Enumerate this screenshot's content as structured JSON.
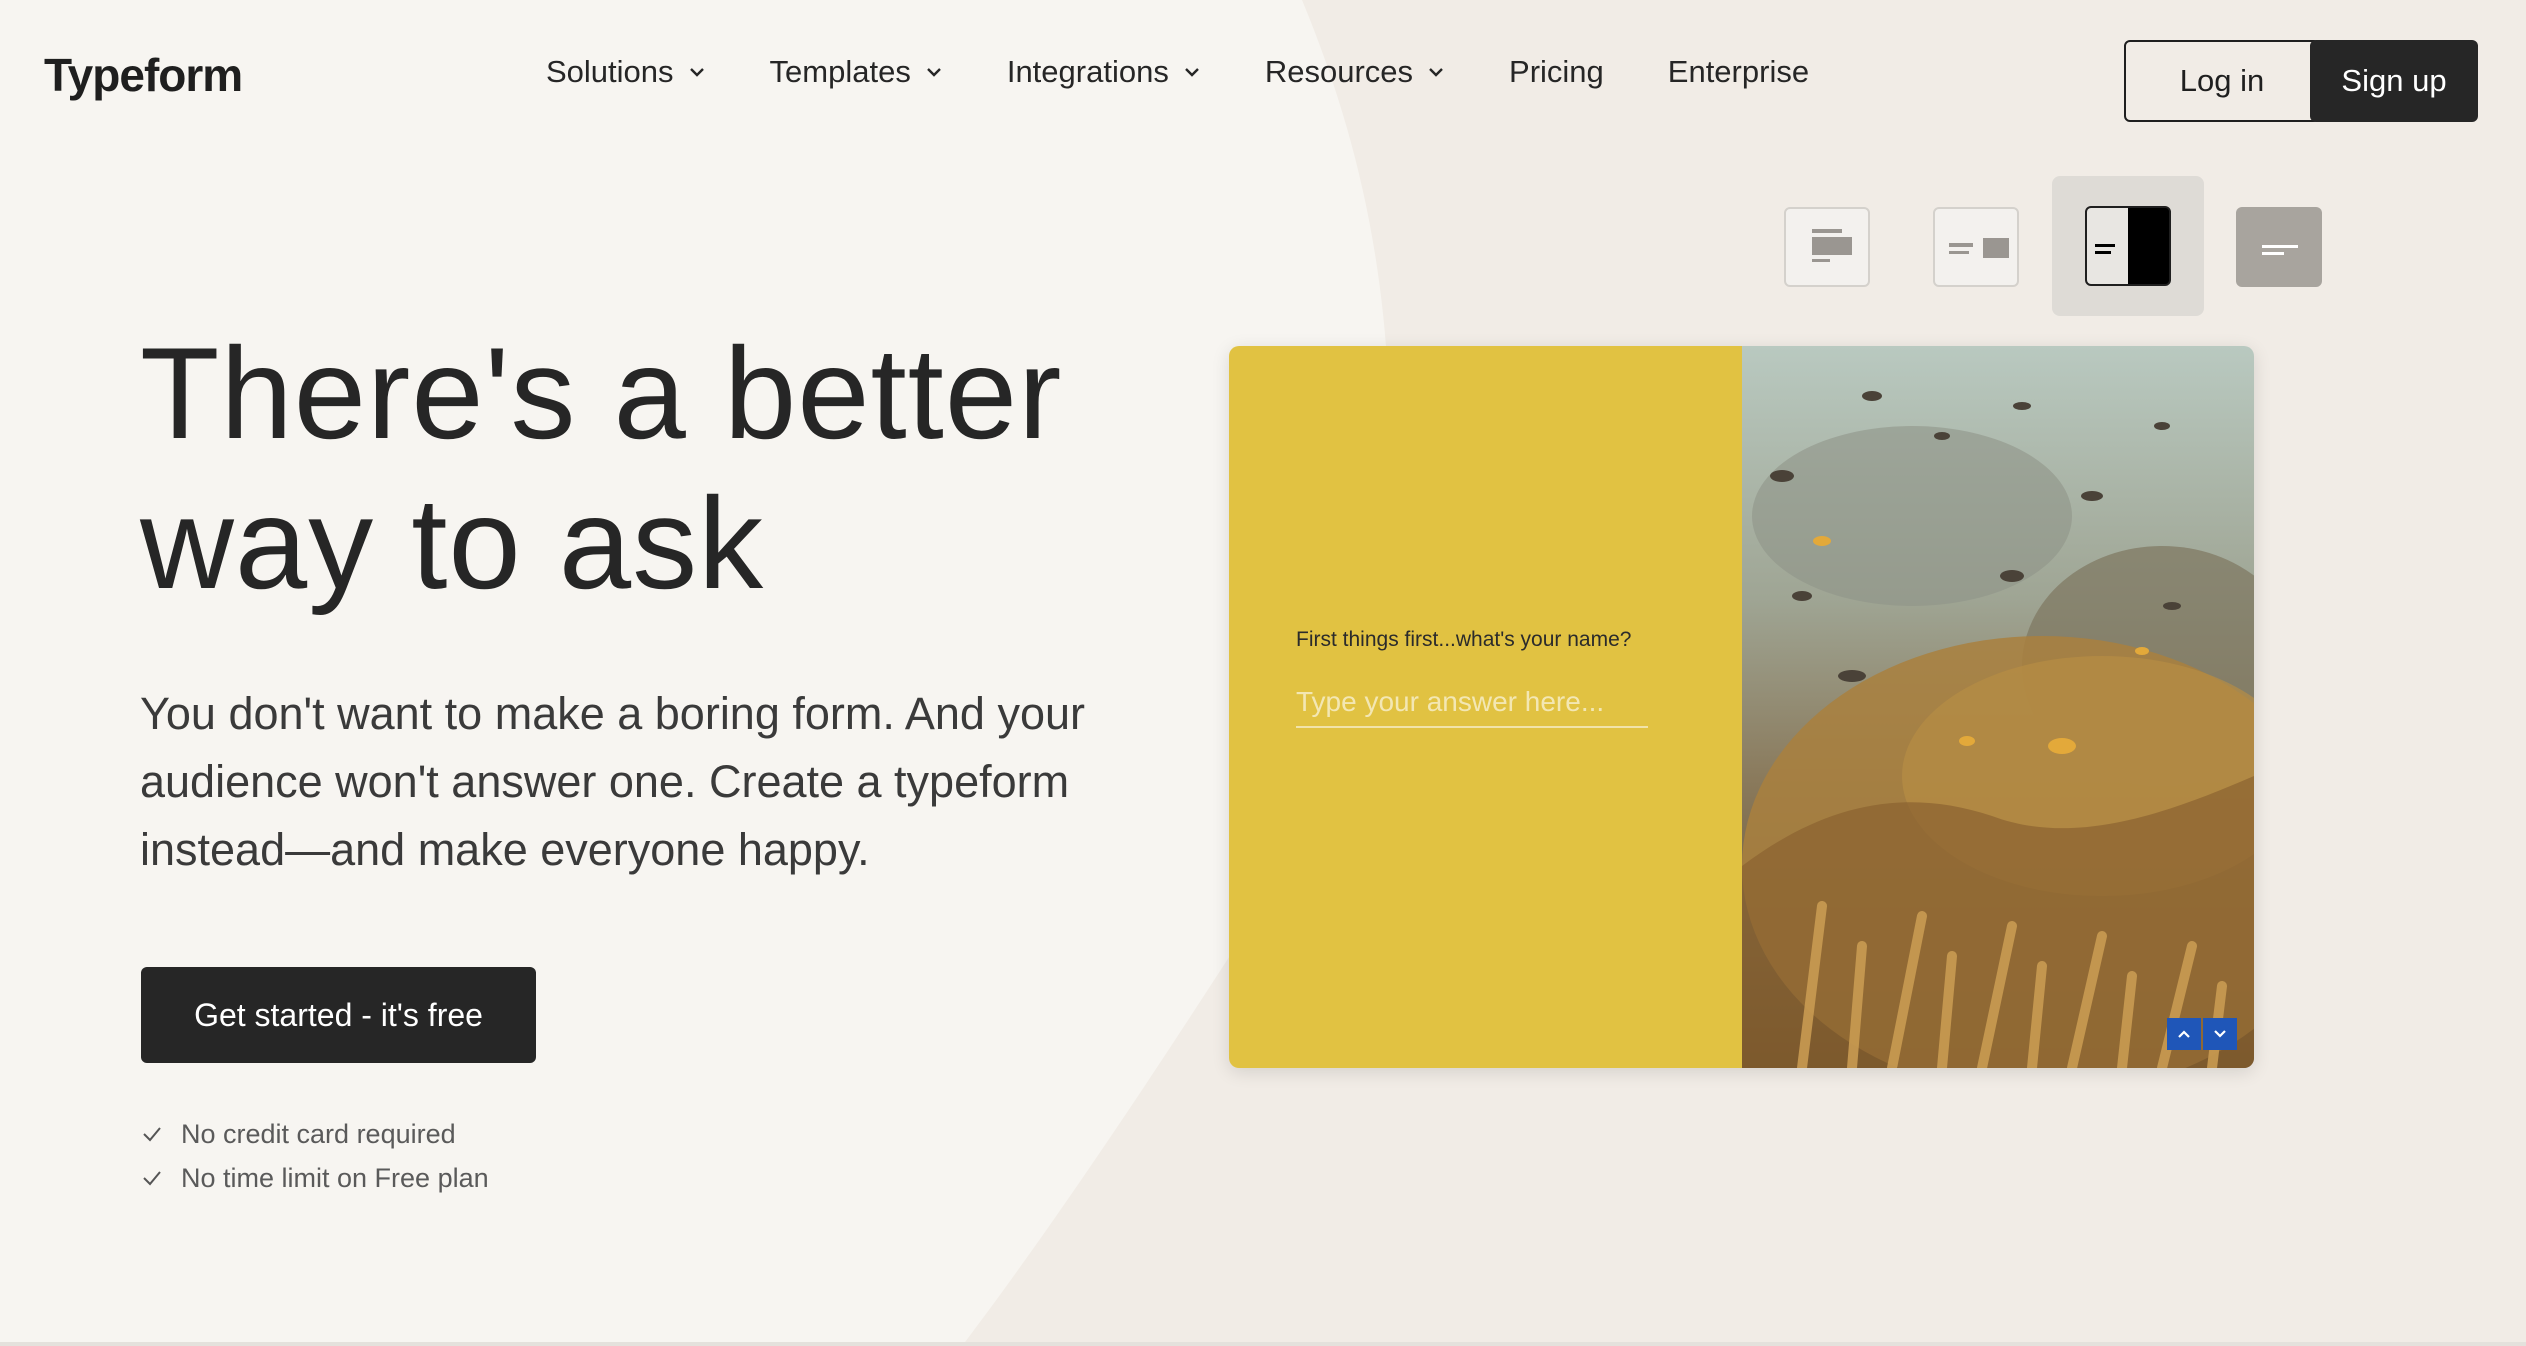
{
  "header": {
    "logo": "Typeform",
    "nav": [
      {
        "label": "Solutions",
        "dropdown": true
      },
      {
        "label": "Templates",
        "dropdown": true
      },
      {
        "label": "Integrations",
        "dropdown": true
      },
      {
        "label": "Resources",
        "dropdown": true
      },
      {
        "label": "Pricing",
        "dropdown": false
      },
      {
        "label": "Enterprise",
        "dropdown": false
      }
    ],
    "login": "Log in",
    "signup": "Sign up"
  },
  "hero": {
    "headline_line1": "There's a better",
    "headline_line2": "way to ask",
    "subtext": "You don't want to make a boring form. And your audience won't answer one. Create a typeform instead—and make everyone happy.",
    "cta": "Get started - it's free",
    "checks": [
      "No credit card required",
      "No time limit on Free plan"
    ]
  },
  "layout_switcher": {
    "options": [
      "stack-layout-icon",
      "split-right-layout-icon",
      "split-half-layout-icon",
      "float-layout-icon"
    ],
    "selected": "split-half-layout-icon"
  },
  "preview": {
    "question": "First things first...what's your name?",
    "placeholder": "Type your answer here...",
    "image": "underwater coral reef with fish",
    "accent": "#e1c242",
    "nav_color": "#1f56b8"
  },
  "colors": {
    "background": "#f7f5f1",
    "shape": "#f1ece6",
    "dark": "#262626"
  }
}
